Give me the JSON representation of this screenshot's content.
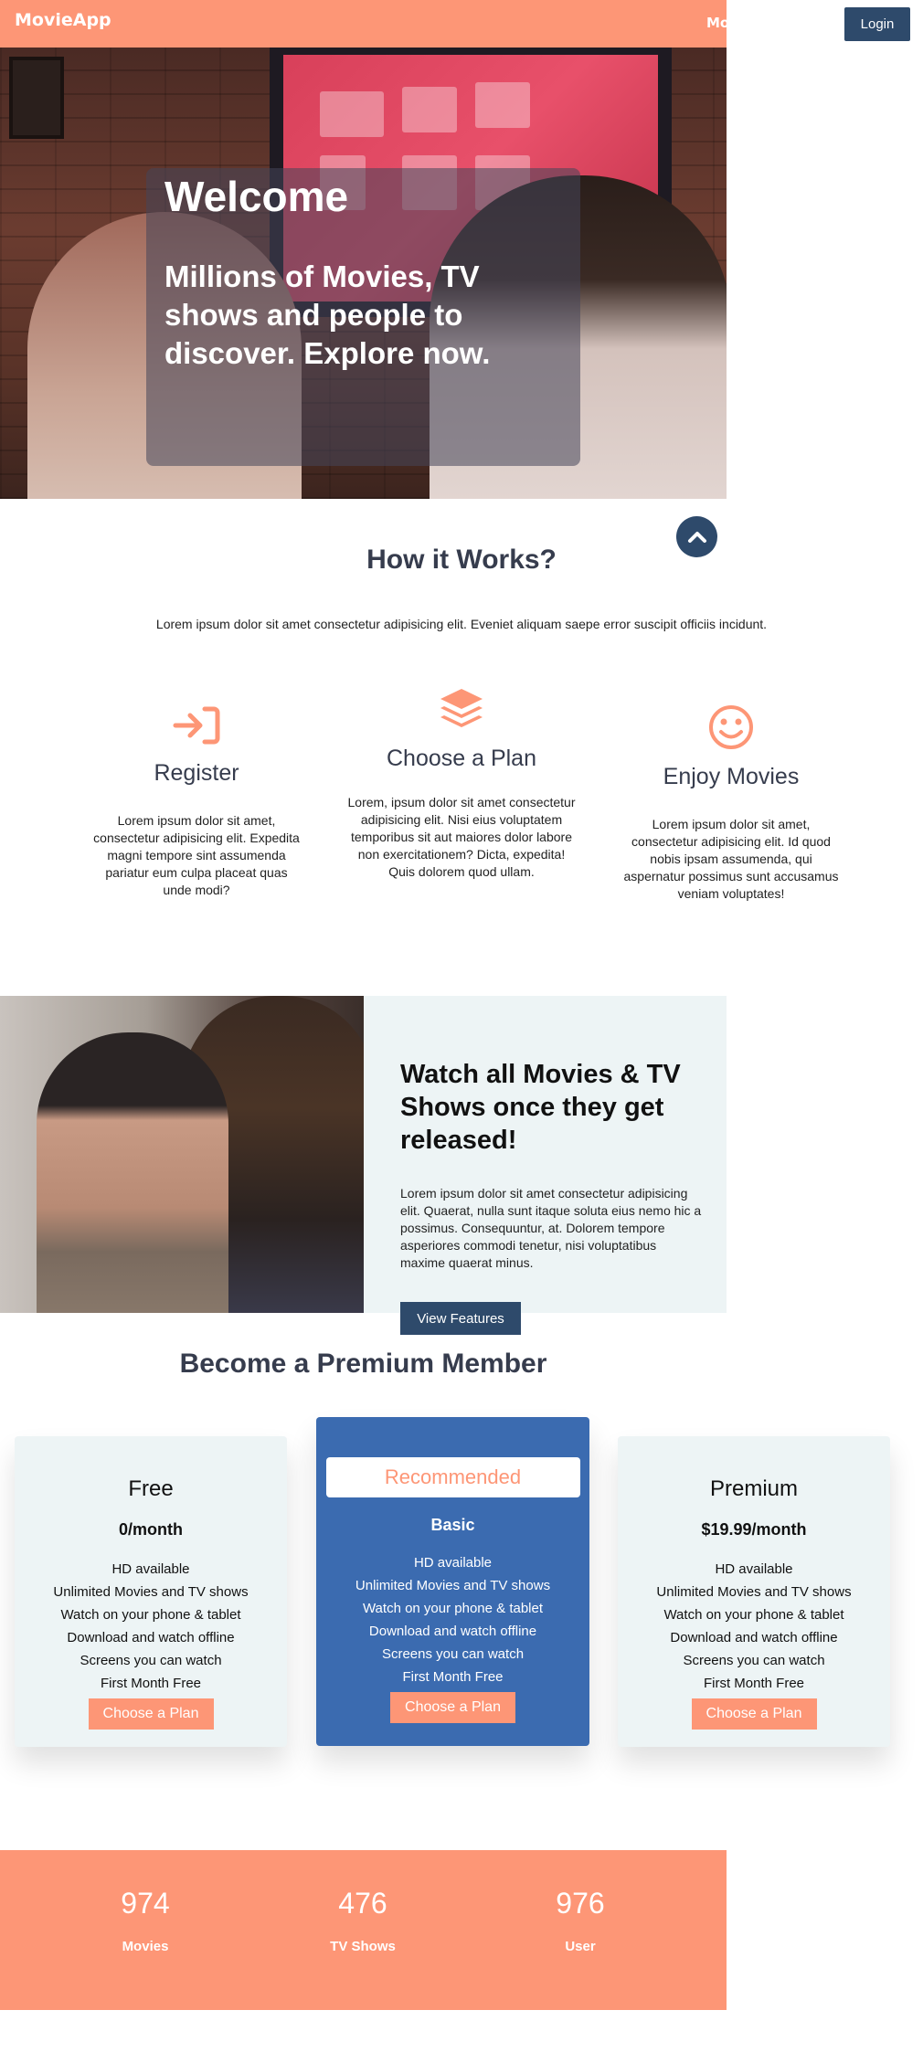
{
  "header": {
    "brand": "MovieApp",
    "nav_partial": "Mo",
    "login_label": "Login"
  },
  "hero": {
    "title": "Welcome",
    "subtitle": "Millions of Movies, TV shows and people to discover. Explore now."
  },
  "how_it_works": {
    "title": "How it Works?",
    "description": "Lorem ipsum dolor sit amet consectetur adipisicing elit. Eveniet aliquam saepe error suscipit officiis incidunt.",
    "steps": [
      {
        "icon": "sign-in-icon",
        "title": "Register",
        "text": "Lorem ipsum dolor sit amet, consectetur adipisicing elit. Expedita magni tempore sint assumenda pariatur eum culpa placeat quas unde modi?"
      },
      {
        "icon": "layers-icon",
        "title": "Choose a Plan",
        "text": "Lorem, ipsum dolor sit amet consectetur adipisicing elit. Nisi eius voluptatem temporibus sit aut maiores dolor labore non exercitationem? Dicta, expedita! Quis dolorem quod ullam."
      },
      {
        "icon": "smile-icon",
        "title": "Enjoy Movies",
        "text": "Lorem ipsum dolor sit amet, consectetur adipisicing elit. Id quod nobis ipsam assumenda, qui aspernatur possimus sunt accusamus veniam voluptates!"
      }
    ]
  },
  "watch": {
    "title": "Watch all Movies & TV Shows once they get released!",
    "text": "Lorem ipsum dolor sit amet consectetur adipisicing elit. Quaerat, nulla sunt itaque soluta eius nemo hic a possimus. Consequuntur, at. Dolorem tempore asperiores commodi tenetur, nisi voluptatibus maxime quaerat minus.",
    "button_label": "View Features"
  },
  "premium": {
    "title": "Become a Premium Member",
    "plans": [
      {
        "name": "Free",
        "price": "0/month",
        "features": [
          "HD available",
          "Unlimited Movies and TV shows",
          "Watch on your phone & tablet",
          "Download and watch offline",
          "Screens you can watch",
          "First Month Free"
        ],
        "button_label": "Choose a Plan"
      },
      {
        "badge": "Recommended",
        "name": "Basic",
        "features": [
          "HD available",
          "Unlimited Movies and TV shows",
          "Watch on your phone & tablet",
          "Download and watch offline",
          "Screens you can watch",
          "First Month Free"
        ],
        "button_label": "Choose a Plan"
      },
      {
        "name": "Premium",
        "price": "$19.99/month",
        "features": [
          "HD available",
          "Unlimited Movies and TV shows",
          "Watch on your phone & tablet",
          "Download and watch offline",
          "Screens you can watch",
          "First Month Free"
        ],
        "button_label": "Choose a Plan"
      }
    ]
  },
  "stats": [
    {
      "value": "974",
      "label": "Movies"
    },
    {
      "value": "476",
      "label": "TV Shows"
    },
    {
      "value": "976",
      "label": "User"
    }
  ],
  "colors": {
    "accent": "#fd9676",
    "navy": "#2e4a6b",
    "blue_card": "#3b6bb0",
    "light_bg": "#edf4f5"
  },
  "icons": {
    "scroll_top": "chevron-up-icon"
  }
}
